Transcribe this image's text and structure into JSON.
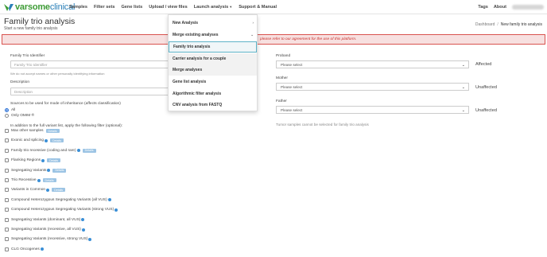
{
  "brand": {
    "name_bold": "varsome",
    "name_thin": "clinical"
  },
  "nav": {
    "samples": "Samples",
    "filter_sets": "Filter sets",
    "gene_lists": "Gene lists",
    "upload": "Upload / view files",
    "launch": "Launch analysis",
    "support": "Support & Manual",
    "tags": "Tags",
    "about": "About"
  },
  "page": {
    "title": "Family trio analysis",
    "subtitle": "Start a new family trio analysis"
  },
  "breadcrumb": {
    "home": "Dashboard",
    "sep": "/",
    "current": "New family trio analysis"
  },
  "alert": {
    "text": "please refer to our agreement for the use of this platform."
  },
  "form": {
    "identifier_label": "Family Trio Identifier",
    "identifier_placeholder": "Family Trio Identifier",
    "identifier_help": "We do not accept names or other personally identifying information",
    "description_label": "Description",
    "description_placeholder": "Description",
    "sources_label": "Sources to be used for mode of inheritance (affects classification)",
    "radio_all": "All",
    "radio_omim": "Only OMIM ®",
    "filter_intro": "In addition to the full variant list, apply the following filter (optional):",
    "edit_label": "Details"
  },
  "filters": [
    {
      "label": "Max other samples",
      "info": false,
      "edit": true
    },
    {
      "label": "Exonic and splicing",
      "info": true,
      "edit": true
    },
    {
      "label": "Family trio recessive (coding and rare)",
      "info": true,
      "edit": true
    },
    {
      "label": "Flanking Regions",
      "info": true,
      "edit": true
    },
    {
      "label": "Segregating Variants",
      "info": true,
      "edit": true
    },
    {
      "label": "Trio Recessive",
      "info": true,
      "edit": true
    },
    {
      "label": "Variants in Common",
      "info": true,
      "edit": true
    },
    {
      "label": "Compound Heterozygous Segregating Variants (all VUS)",
      "info": true,
      "edit": false
    },
    {
      "label": "Compound Heterozygous Segregating Variants (strong VUS)",
      "info": true,
      "edit": false
    },
    {
      "label": "Segregating Variants (dominant, all VUS)",
      "info": true,
      "edit": false
    },
    {
      "label": "Segregating Variants (recessive, all VUS)",
      "info": true,
      "edit": false
    },
    {
      "label": "Segregating Variants (recessive, strong VUS)",
      "info": true,
      "edit": false
    },
    {
      "label": "CLG Oncogenes",
      "info": true,
      "edit": false
    }
  ],
  "trio": {
    "proband_label": "Proband",
    "mother_label": "Mother",
    "father_label": "Father",
    "select_placeholder": "Please select",
    "proband_status": "Affected",
    "mother_status": "Unaffected",
    "father_status": "Unaffected",
    "tumor_note": "Tumor samples cannot be selected for family trio analysis"
  },
  "dropdown": {
    "items": [
      {
        "label": "New Analysis",
        "bold": true,
        "caret": true
      },
      {
        "label": "Merge existing analyses",
        "bold": true,
        "caret": true
      },
      {
        "label": "Family trio analysis",
        "bold": true
      },
      {
        "label": "Carrier analysis for a couple",
        "bold": true
      },
      {
        "label": "Merge analyses",
        "bold": true
      },
      {
        "label": "Gene list analysis",
        "bold": true
      },
      {
        "label": "Algorithmic filter analysis",
        "bold": true
      },
      {
        "label": "CNV analysis from FASTQ",
        "bold": true
      }
    ]
  },
  "colors": {
    "brand_green": "#3d9b35",
    "alert_border": "#d9534f",
    "alert_text": "#c9302c",
    "active_border": "#5eb2c7"
  }
}
